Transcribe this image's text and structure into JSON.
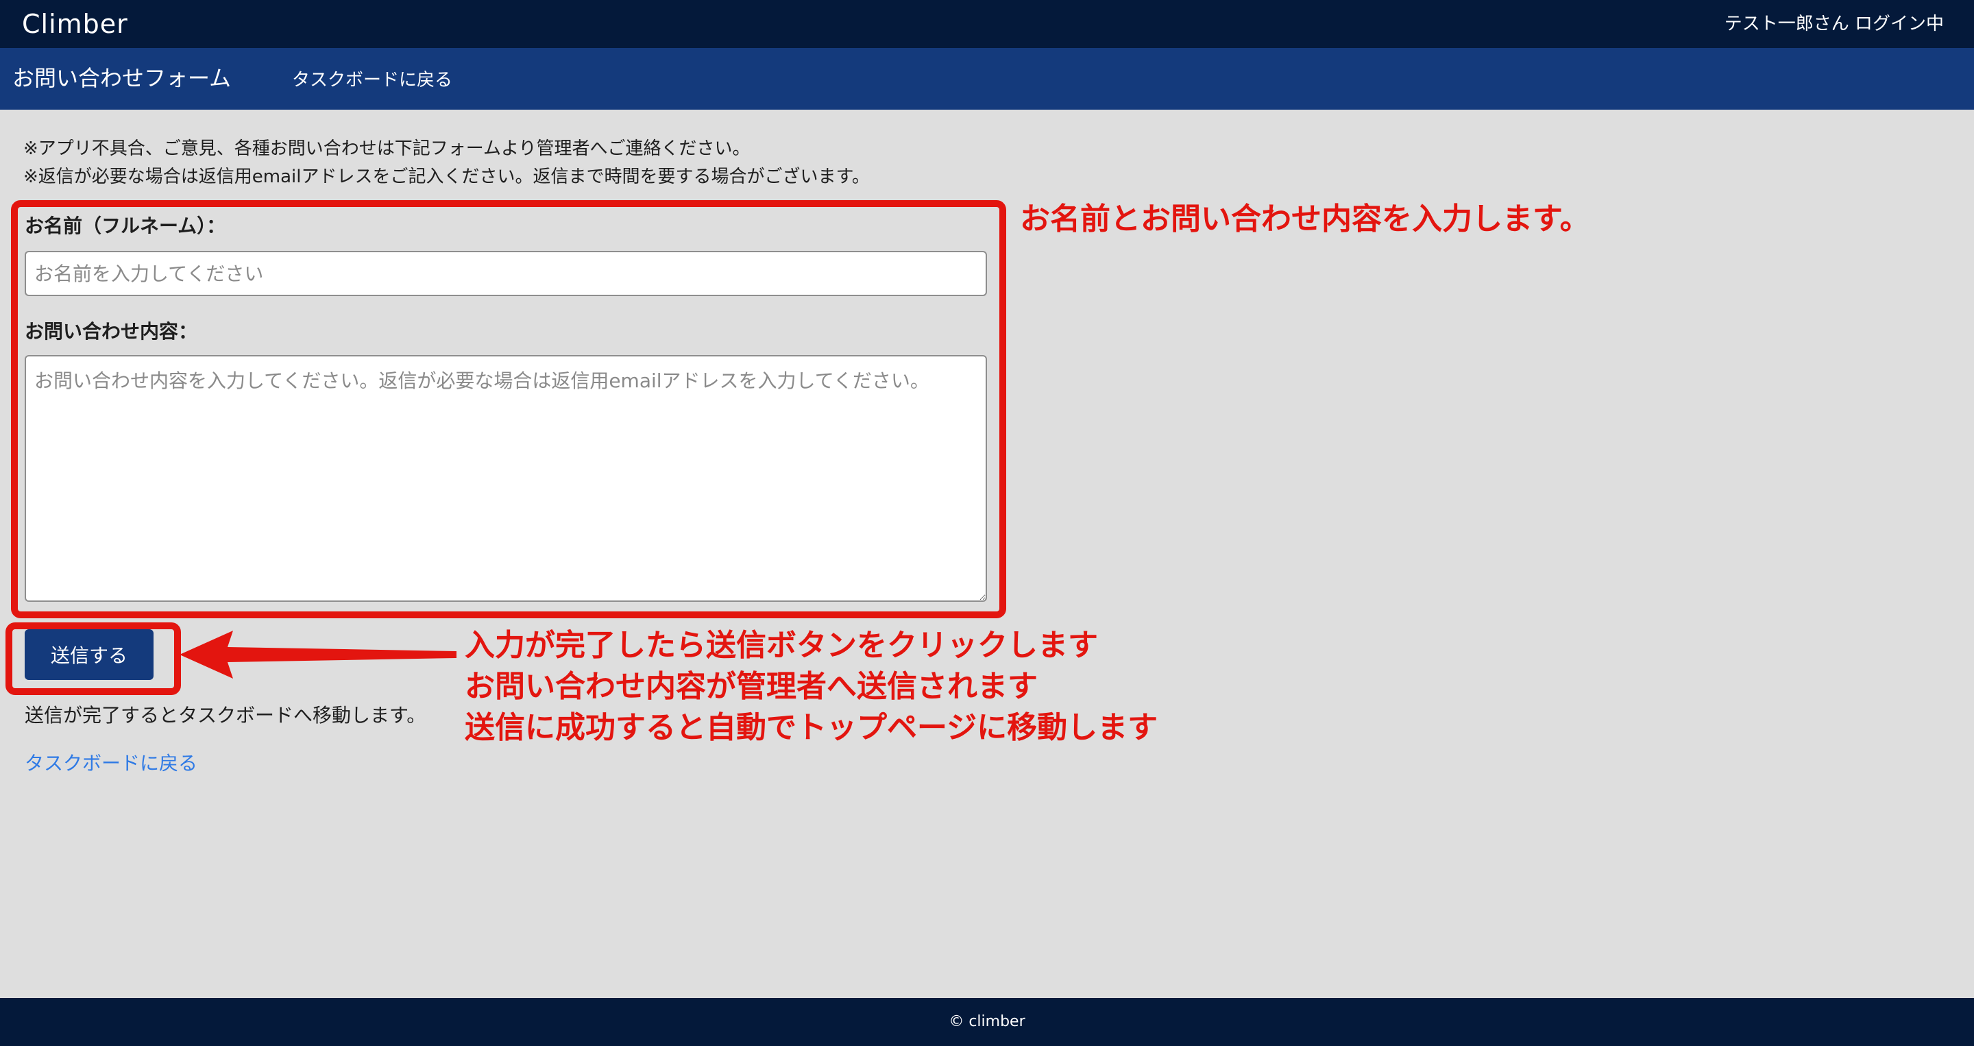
{
  "header": {
    "brand": "Climber",
    "login_status": "テスト一郎さん ログイン中"
  },
  "subnav": {
    "title": "お問い合わせフォーム",
    "back_link": "タスクボードに戻る"
  },
  "notices": [
    "※アプリ不具合、ご意見、各種お問い合わせは下記フォームより管理者へご連絡ください。",
    "※返信が必要な場合は返信用emailアドレスをご記入ください。返信まで時間を要する場合がございます。"
  ],
  "form": {
    "name_label": "お名前（フルネーム）：",
    "name_value": "",
    "name_placeholder": "お名前を入力してください",
    "message_label": "お問い合わせ内容：",
    "message_value": "",
    "message_placeholder": "お問い合わせ内容を入力してください。返信が必要な場合は返信用emailアドレスを入力してください。",
    "submit_label": "送信する",
    "after_note": "送信が完了するとタスクボードへ移動します。",
    "back_link": "タスクボードに戻る"
  },
  "annotations": {
    "form_note": "お名前とお問い合わせ内容を入力します。",
    "submit_notes": [
      "入力が完了したら送信ボタンをクリックします",
      "お問い合わせ内容が管理者へ送信されます",
      "送信に成功すると自動でトップページに移動します"
    ],
    "color": "#e3150f"
  },
  "footer": {
    "copyright": "© climber"
  },
  "colors": {
    "header_bg": "#04193a",
    "subnav_bg": "#143a7c",
    "page_bg": "#dedede",
    "link": "#2f7ae5",
    "button_bg": "#143a7c"
  }
}
